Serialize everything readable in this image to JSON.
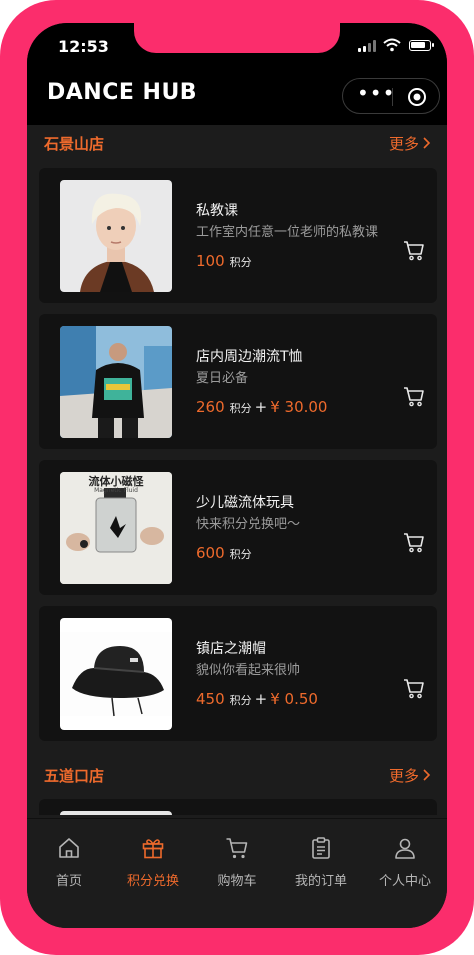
{
  "status_bar": {
    "time": "12:53"
  },
  "app": {
    "title": "DANCE HUB"
  },
  "capsule": {
    "more_icon": "more-dots-icon",
    "close_icon": "target-icon"
  },
  "sections": [
    {
      "name": "石景山店",
      "more_label": "更多",
      "products": [
        {
          "name": "私教课",
          "desc": "工作室内任意一位老师的私教课",
          "points": "100",
          "points_unit": "积分",
          "plus": "",
          "money": ""
        },
        {
          "name": "店内周边潮流T恤",
          "desc": "夏日必备",
          "points": "260",
          "points_unit": "积分",
          "plus": "+",
          "money": "¥ 30.00"
        },
        {
          "name": "少儿磁流体玩具",
          "desc": "快来积分兑换吧～",
          "points": "600",
          "points_unit": "积分",
          "plus": "",
          "money": ""
        },
        {
          "name": "镇店之潮帽",
          "desc": "貌似你看起来很帅",
          "points": "450",
          "points_unit": "积分",
          "plus": "+",
          "money": "¥ 0.50"
        }
      ]
    },
    {
      "name": "五道口店",
      "more_label": "更多",
      "products": []
    }
  ],
  "thumb_text": {
    "toy_title": "流体小磁怪",
    "toy_sub": "Magnetic Fluid"
  },
  "tabbar": [
    {
      "label": "首页",
      "icon": "home-icon",
      "active": false
    },
    {
      "label": "积分兑换",
      "icon": "gift-icon",
      "active": true
    },
    {
      "label": "购物车",
      "icon": "cart-icon",
      "active": false
    },
    {
      "label": "我的订单",
      "icon": "clipboard-icon",
      "active": false
    },
    {
      "label": "个人中心",
      "icon": "user-icon",
      "active": false
    }
  ],
  "colors": {
    "accent": "#ee6a2c",
    "frame": "#fb2d6c",
    "background": "#1c1c1c",
    "card": "#121212"
  }
}
